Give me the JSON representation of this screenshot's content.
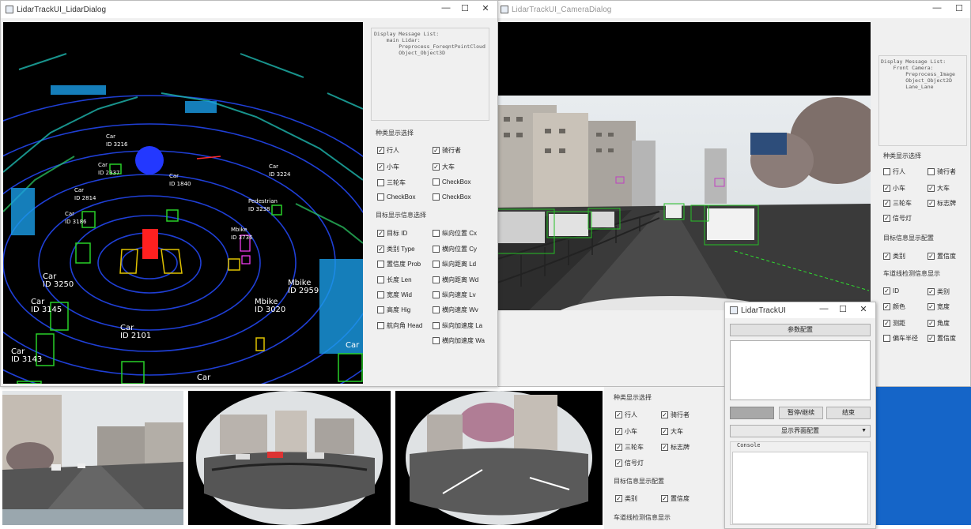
{
  "camera_window": {
    "title": "LidarTrackUI_CameraDialog",
    "message_list": "Display Message List:\n    Front Camera:\n        Preprocess_Image\n        Object_Object2D\n        Lane_Lane",
    "categories_title": "种类显示选择",
    "categories": [
      {
        "label": "行人",
        "checked": false
      },
      {
        "label": "骑行者",
        "checked": false
      },
      {
        "label": "小车",
        "checked": true
      },
      {
        "label": "大车",
        "checked": true
      },
      {
        "label": "三轮车",
        "checked": true
      },
      {
        "label": "标志牌",
        "checked": true
      },
      {
        "label": "信号灯",
        "checked": true
      }
    ],
    "info_title": "目标信息显示配置",
    "info": [
      {
        "label": "类别",
        "checked": true
      },
      {
        "label": "置信度",
        "checked": true
      }
    ],
    "lane_title": "车道线检测信息显示",
    "lane": [
      {
        "label": "ID",
        "checked": true
      },
      {
        "label": "类别",
        "checked": true
      },
      {
        "label": "颜色",
        "checked": true
      },
      {
        "label": "宽度",
        "checked": true
      },
      {
        "label": "测距",
        "checked": true
      },
      {
        "label": "角度",
        "checked": true
      },
      {
        "label": "偏车半径",
        "checked": false
      },
      {
        "label": "置信度",
        "checked": true
      }
    ]
  },
  "lidar_window": {
    "title": "LidarTrackUI_LidarDialog",
    "message_list": "Display Message List:\n    main Lidar:\n        Preprocess_ForeqntPointCloud\n        Object_Object3D",
    "categories_title": "种类显示选择",
    "categories": [
      {
        "label": "行人",
        "checked": true
      },
      {
        "label": "骑行者",
        "checked": true
      },
      {
        "label": "小车",
        "checked": true
      },
      {
        "label": "大车",
        "checked": true
      },
      {
        "label": "三轮车",
        "checked": false
      },
      {
        "label": "CheckBox",
        "checked": false
      },
      {
        "label": "CheckBox",
        "checked": false
      },
      {
        "label": "CheckBox",
        "checked": false
      }
    ],
    "info_title": "目标显示信息选择",
    "info": [
      {
        "label": "目标 ID",
        "checked": true
      },
      {
        "label": "纵向位置 Cx",
        "checked": false
      },
      {
        "label": "类别 Type",
        "checked": true
      },
      {
        "label": "横向位置 Cy",
        "checked": false
      },
      {
        "label": "置信度 Prob",
        "checked": false
      },
      {
        "label": "纵向距离 Ld",
        "checked": false
      },
      {
        "label": "长度 Len",
        "checked": false
      },
      {
        "label": "横向距离 Wd",
        "checked": false
      },
      {
        "label": "宽度 Wid",
        "checked": false
      },
      {
        "label": "纵向速度 Lv",
        "checked": false
      },
      {
        "label": "高度 Hig",
        "checked": false
      },
      {
        "label": "横向速度 Wv",
        "checked": false
      },
      {
        "label": "航向角 Head",
        "checked": false
      },
      {
        "label": "纵向加速度 La",
        "checked": false
      },
      {
        "label": "横向加速度 Wa",
        "checked": false
      }
    ],
    "labels": [
      {
        "cls": "Car",
        "id": "ID 3250"
      },
      {
        "cls": "Car",
        "id": "ID 3145"
      },
      {
        "cls": "Car",
        "id": "ID 2101"
      },
      {
        "cls": "Car",
        "id": "ID 3143"
      },
      {
        "cls": "Mbike",
        "id": "ID 2959"
      },
      {
        "cls": "Mbike",
        "id": "ID 3020"
      },
      {
        "cls": "Car",
        "id": "ID 3224"
      },
      {
        "cls": "Pedestrian",
        "id": "ID 3238"
      },
      {
        "cls": "Mbike",
        "id": "ID 3736"
      },
      {
        "cls": "Car",
        "id": "ID 3186"
      },
      {
        "cls": "Car",
        "id": "ID 2814"
      },
      {
        "cls": "Car",
        "id": "ID 2337"
      },
      {
        "cls": "Car",
        "id": "ID 1840"
      },
      {
        "cls": "Car",
        "id": "ID 3216"
      },
      {
        "cls": "Car",
        "id": ""
      },
      {
        "cls": "Car",
        "id": ""
      }
    ]
  },
  "control_window": {
    "title": "LidarTrackUI",
    "param_button": "参数配置",
    "pause_button": "暂停/继续",
    "exit_button": "结束",
    "display_config": "显示界面配置",
    "console_label": "Console"
  },
  "surround_panel": {
    "categories_title": "种类显示选择",
    "categories": [
      {
        "label": "行人",
        "checked": true
      },
      {
        "label": "骑行者",
        "checked": true
      },
      {
        "label": "小车",
        "checked": true
      },
      {
        "label": "大车",
        "checked": true
      },
      {
        "label": "三轮车",
        "checked": true
      },
      {
        "label": "标志牌",
        "checked": true
      },
      {
        "label": "信号灯",
        "checked": true
      }
    ],
    "info_title": "目标信息显示配置",
    "info": [
      {
        "label": "类别",
        "checked": true
      },
      {
        "label": "置信度",
        "checked": true
      }
    ],
    "lane_title": "车道线检测信息显示"
  },
  "window_controls": {
    "minimize": "—",
    "maximize": "☐",
    "close": "✕"
  }
}
